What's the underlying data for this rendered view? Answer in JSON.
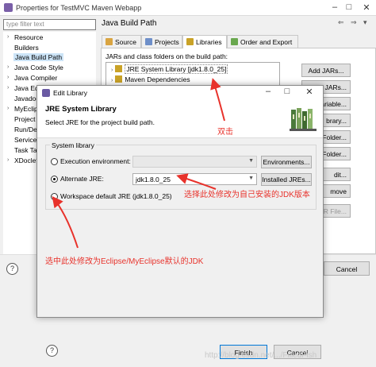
{
  "window": {
    "title": "Properties for TestMVC Maven Webapp"
  },
  "sidebar": {
    "filter_placeholder": "type filter text",
    "items": [
      {
        "label": "Resource",
        "expandable": true
      },
      {
        "label": "Builders",
        "expandable": false
      },
      {
        "label": "Java Build Path",
        "expandable": false,
        "selected": true
      },
      {
        "label": "Java Code Style",
        "expandable": true
      },
      {
        "label": "Java Compiler",
        "expandable": true
      },
      {
        "label": "Java Ed",
        "expandable": true
      },
      {
        "label": "Javadoc",
        "expandable": false
      },
      {
        "label": "MyEclip",
        "expandable": true
      },
      {
        "label": "Project",
        "expandable": false
      },
      {
        "label": "Run/De",
        "expandable": false
      },
      {
        "label": "Service",
        "expandable": false
      },
      {
        "label": "Task Ta",
        "expandable": false
      },
      {
        "label": "XDoclet",
        "expandable": true
      }
    ]
  },
  "main": {
    "title": "Java Build Path",
    "tabs": [
      {
        "label": "Source",
        "color": "#d9a441"
      },
      {
        "label": "Projects",
        "color": "#6e8fc9"
      },
      {
        "label": "Libraries",
        "color": "#c9a227",
        "active": true
      },
      {
        "label": "Order and Export",
        "color": "#6aa84f"
      }
    ],
    "jars_label": "JARs and class folders on the build path:",
    "jars": [
      {
        "label": "JRE System Library [jdk1.8.0_25]"
      },
      {
        "label": "Maven Dependencies"
      }
    ],
    "buttons": {
      "add_jars": "Add JARs...",
      "external_jars": "rnal JARs...",
      "variable": "ariable...",
      "library": "brary...",
      "class_folder": "Class Folder...",
      "ext_class_folder": "Class Folder...",
      "edit": "dit...",
      "remove": "move",
      "jar_file": "JAR File..."
    }
  },
  "bottom": {
    "cancel1": "Cancel",
    "finish": "Finish",
    "cancel2": "Cancel"
  },
  "dialog": {
    "title": "Edit Library",
    "heading": "JRE System Library",
    "description": "Select JRE for the project build path.",
    "group_label": "System library",
    "options": {
      "execution_env": {
        "label": "Execution environment:",
        "value": "",
        "selected": false
      },
      "alternate_jre": {
        "label": "Alternate JRE:",
        "value": "jdk1.8.0_25",
        "selected": true
      },
      "workspace_default": {
        "label": "Workspace default JRE (jdk1.8.0_25)",
        "selected": false
      }
    },
    "environments_button": "Environments...",
    "installed_jres_button": "Installed JREs..."
  },
  "annotations": {
    "double_click": "双击",
    "select_own_jdk": "选择此处修改为自己安装的JDK版本",
    "select_default_jdk": "选中此处修改为Eclipse/MyEclipse默认的JDK",
    "color": "#e8322b"
  },
  "watermark": "http://blog.csdn.net/.../FilledFish"
}
